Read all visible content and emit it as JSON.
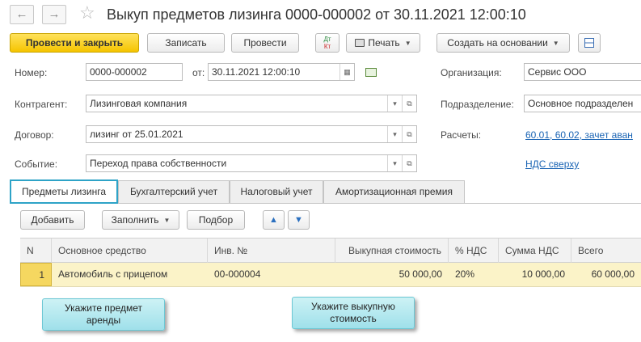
{
  "window": {
    "title": "Выкуп предметов лизинга 0000-000002 от 30.11.2021 12:00:10",
    "back_glyph": "←",
    "forward_glyph": "→",
    "star_glyph": "☆"
  },
  "toolbar": {
    "post_close_label": "Провести и закрыть",
    "save_label": "Записать",
    "post_label": "Провести",
    "dtkt_top": "Дт",
    "dtkt_bottom": "Кт",
    "print_label": "Печать",
    "create_based_label": "Создать на основании"
  },
  "header": {
    "number_label": "Номер:",
    "number_value": "0000-000002",
    "from_label": "от:",
    "date_value": "30.11.2021 12:00:10",
    "org_label": "Организация:",
    "org_value": "Сервис ООО",
    "contractor_label": "Контрагент:",
    "contractor_value": "Лизинговая компания",
    "division_label": "Подразделение:",
    "division_value": "Основное подразделен",
    "contract_label": "Договор:",
    "contract_value": "лизинг от 25.01.2021",
    "payments_label": "Расчеты:",
    "payments_value": "60.01, 60.02, зачет аван",
    "event_label": "Событие:",
    "event_value": "Переход права собственности",
    "vat_link": "НДС сверху"
  },
  "tabs": [
    {
      "label": "Предметы лизинга",
      "active": true
    },
    {
      "label": "Бухгалтерский учет",
      "active": false
    },
    {
      "label": "Налоговый учет",
      "active": false
    },
    {
      "label": "Амортизационная премия",
      "active": false
    }
  ],
  "table_toolbar": {
    "add_label": "Добавить",
    "fill_label": "Заполнить",
    "select_label": "Подбор"
  },
  "table": {
    "columns": [
      "N",
      "Основное средство",
      "Инв. №",
      "Выкупная стоимость",
      "% НДС",
      "Сумма НДС",
      "Всего"
    ],
    "rows": [
      {
        "n": "1",
        "asset": "Автомобиль с прицепом",
        "inv": "00-000004",
        "cost": "50 000,00",
        "vat_rate": "20%",
        "vat_sum": "10 000,00",
        "total": "60 000,00"
      }
    ]
  },
  "callouts": {
    "subject_line1": "Укажите предмет",
    "subject_line2": "аренды",
    "cost_line1": "Укажите выкупную",
    "cost_line2": "стоимость"
  },
  "colors": {
    "primary_button": "#f5c400",
    "active_tab_border": "#2ea3c7",
    "selected_row": "#fbf3c8",
    "callout": "#b5e9ef",
    "link": "#1a64b4"
  }
}
